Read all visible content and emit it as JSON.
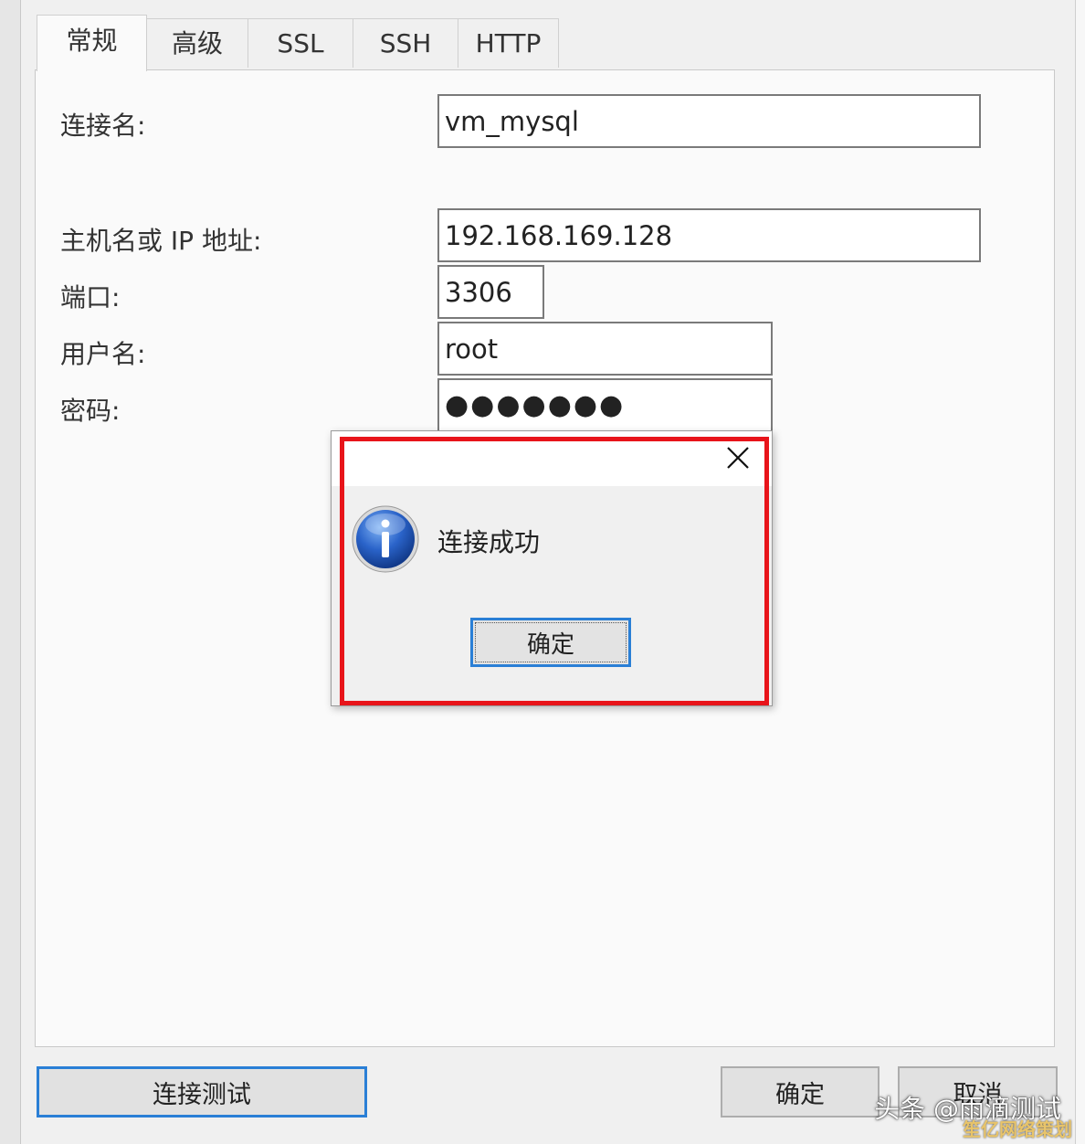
{
  "tabs": [
    {
      "label": "常规"
    },
    {
      "label": "高级"
    },
    {
      "label": "SSL"
    },
    {
      "label": "SSH"
    },
    {
      "label": "HTTP"
    }
  ],
  "form": {
    "connection_name": {
      "label": "连接名:",
      "value": "vm_mysql"
    },
    "host": {
      "label": "主机名或 IP 地址:",
      "value": "192.168.169.128"
    },
    "port": {
      "label": "端口:",
      "value": "3306"
    },
    "username": {
      "label": "用户名:",
      "value": "root"
    },
    "password": {
      "label": "密码:",
      "value": "●●●●●●●"
    }
  },
  "dialog": {
    "message": "连接成功",
    "ok_label": "确定",
    "close_icon": "close-icon",
    "info_icon": "info-icon",
    "highlight_color": "#e8141a"
  },
  "buttons": {
    "test_connection": "连接测试",
    "ok": "确定",
    "cancel": "取消"
  },
  "watermark": {
    "text": "头条 @雨滴测试",
    "site": "笙亿网络策划"
  }
}
